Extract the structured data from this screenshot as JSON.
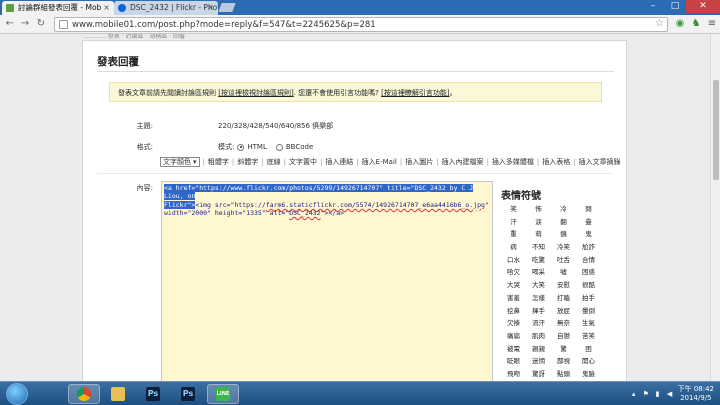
{
  "browser": {
    "tabs": [
      {
        "title": "討論群組發表回覆 - Mob",
        "active": true
      },
      {
        "title": "DSC_2432 | Flickr - Photo",
        "active": false
      }
    ],
    "url": "www.mobile01.com/post.php?mode=reply&f=547&t=2245625&p=281"
  },
  "page": {
    "top_strip": "............ 發表 · 討論區 · 站務區 · 回覆",
    "title": "發表回覆",
    "notice": {
      "prefix": "發表文章前請先閱讀討論區規則",
      "link1": "[按這裡檢視討論區規則]",
      "middle": ". 您還不會使用引言功能嗎?",
      "link2": "[按這裡瞭解引言功能]",
      "suffix": "。"
    },
    "subject_label": "主題:",
    "subject_value": "220/328/428/540/640/856 俱樂部",
    "mode_label": "模式:",
    "mode_html": "HTML",
    "mode_bbcode": "BBCode",
    "format_label": "格式:",
    "font_color_select": "文字顏色",
    "toolbar_items": [
      "粗體字",
      "斜體字",
      "底線",
      "文字置中",
      "插入連結",
      "插入E-Mail",
      "插入圖片",
      "插入內建檔案",
      "插入多媒體檔",
      "插入表格",
      "插入文章摘錄"
    ],
    "content_label": "內容:",
    "editor_lines": {
      "l1_sel": "<a href=\"https://www.flickr.com/photos/5299/14926714707\" title=\"DSC_2432 by C J Liou, on",
      "l2_sel": "Flickr\">",
      "l2_rest_a": "<img src=\"https://",
      "l2_err": "farm6.staticflickr.com/5574/14926714707_e6aa4416b6_o.jpg",
      "l2_rest_b": "\"",
      "l3_a": "width=\"2000\" height=\"1335\" alt=\"",
      "l3_err": "DSC_2432",
      "l3_b": "\"></a>"
    },
    "smiley_title": "表情符號",
    "smileys": [
      "笑",
      "怖",
      "冷",
      "問",
      "汗",
      "淚",
      "翻",
      "疊",
      "重",
      "萌",
      "鏡",
      "鬼",
      "病",
      "不知",
      "冷笑",
      "尬詐",
      "口水",
      "吃驚",
      "吐舌",
      "合情",
      "哈欠",
      "喝采",
      "噓",
      "困惑",
      "大哭",
      "大笑",
      "安慰",
      "很酷",
      "害羞",
      "怎樣",
      "打瞌",
      "拍手",
      "挖鼻",
      "揮手",
      "放屁",
      "暈倒",
      "欠揍",
      "流汗",
      "無奈",
      "生氣",
      "痛扁",
      "肌肉",
      "自戀",
      "苦笑",
      "被電",
      "親親",
      "驚",
      "困",
      "眨眼",
      "迷惘",
      "鄙視",
      "開心",
      "飛吻",
      "驚訝",
      "點頭",
      "鬼臉",
      "鼓掌",
      "噴茶"
    ]
  },
  "taskbar": {
    "apps": [
      "Chrome",
      "Explorer",
      "Photoshop",
      "Photoshop",
      "LINE"
    ],
    "time": "下午 08:42",
    "date": "2014/9/5"
  }
}
